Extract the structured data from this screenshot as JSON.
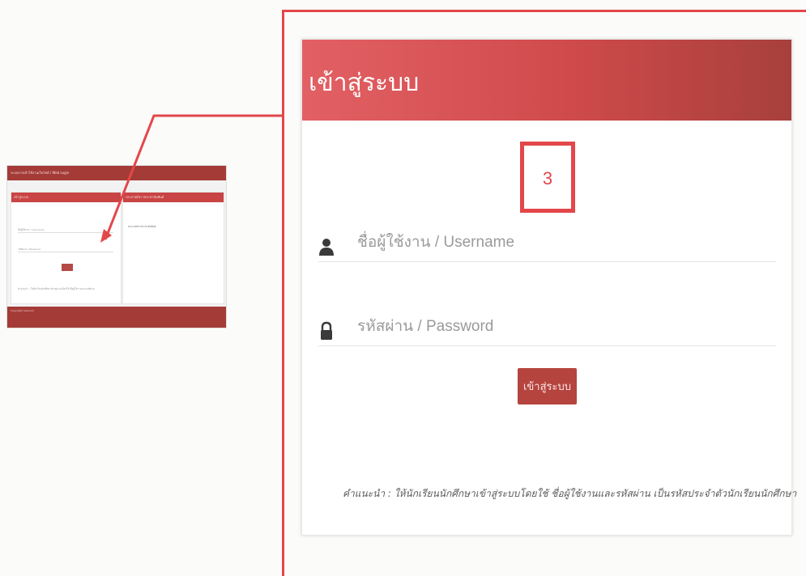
{
  "thumbnail": {
    "topbar_text": "ระบบการเข้าใช้งานเว็บไซต์ / Web Login",
    "login_header": "เข้าสู่ระบบ",
    "news_header": "ประกาศ/ข่าวประชาสัมพันธ์",
    "username_hint": "ชื่อผู้ใช้งาน / Username",
    "password_hint": "รหัสผ่าน / Password",
    "hint_text": "คำแนะนำ : ให้นักเรียนนักศึกษาเข้าสู่ระบบโดยใช้ ชื่อผู้ใช้งานและรหัสผ่าน",
    "news_row": "ประกาศข่าวประชาสัมพันธ์",
    "footer_text": "Copyright reserved"
  },
  "login": {
    "title": "เข้าสู่ระบบ",
    "username_placeholder": "ชื่อผู้ใช้งาน / Username",
    "password_placeholder": "รหัสผ่าน / Password",
    "submit_label": "เข้าสู่ระบบ",
    "hint": "คำแนะนำ : ให้นักเรียนนักศึกษาเข้าสู่ระบบโดยใช้ ชื่อผู้ใช้งานและรหัสผ่าน เป็นรหัสประจำตัวนักเรียนนักศึกษา"
  },
  "annotation": {
    "step_number": "3",
    "color": "#e3474a"
  },
  "icons": {
    "username": "user-icon",
    "password": "lock-icon"
  }
}
